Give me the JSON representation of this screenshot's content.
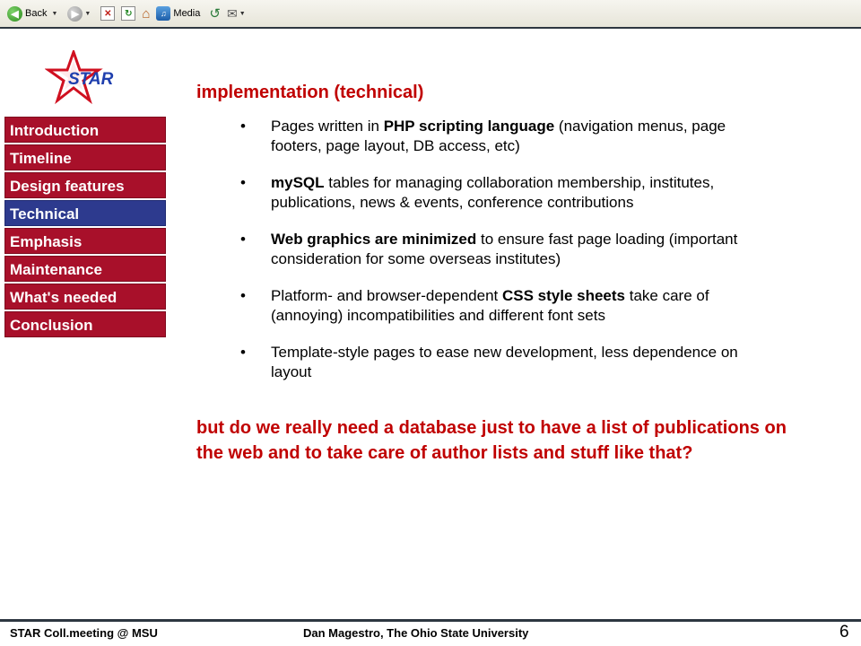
{
  "toolbar": {
    "back_label": "Back",
    "media_label": "Media"
  },
  "logo": {
    "text": "STAR"
  },
  "nav": {
    "items": [
      {
        "label": "Introduction"
      },
      {
        "label": "Timeline"
      },
      {
        "label": "Design features"
      },
      {
        "label": "Technical"
      },
      {
        "label": "Emphasis"
      },
      {
        "label": "Maintenance"
      },
      {
        "label": "What's needed"
      },
      {
        "label": "Conclusion"
      }
    ],
    "active": "Technical",
    "color": "#a8102a",
    "active_color": "#2d3a8e"
  },
  "main": {
    "heading": "implementation (technical)",
    "bullets": [
      {
        "bold_pre": "",
        "text_pre": "Pages written in ",
        "bold": "PHP scripting language",
        "text": " (navigation menus, page footers, page layout, DB access, etc)"
      },
      {
        "bold_pre": "mySQL",
        "text_pre": "",
        "bold": "",
        "text": " tables for managing collaboration membership, institutes, publications, news & events, conference contributions"
      },
      {
        "bold_pre": "Web graphics are minimized",
        "text_pre": "",
        "bold": "",
        "text": " to ensure fast page loading (important consideration for some overseas institutes)"
      },
      {
        "bold_pre": "",
        "text_pre": "Platform- and browser-dependent ",
        "bold": "CSS style sheets",
        "text": " take care of (annoying) incompatibilities and different font sets"
      },
      {
        "bold_pre": "",
        "text_pre": "Template-style pages to ease new development, less dependence on layout",
        "bold": "",
        "text": ""
      }
    ],
    "question": "but do we really need a database just to have a list of publications on the web and to take care of author lists and stuff like that?",
    "accent_color": "#c00000"
  },
  "footer": {
    "left": "STAR Coll.meeting @ MSU",
    "center": "Dan Magestro, The Ohio State University",
    "page_number": "6"
  }
}
